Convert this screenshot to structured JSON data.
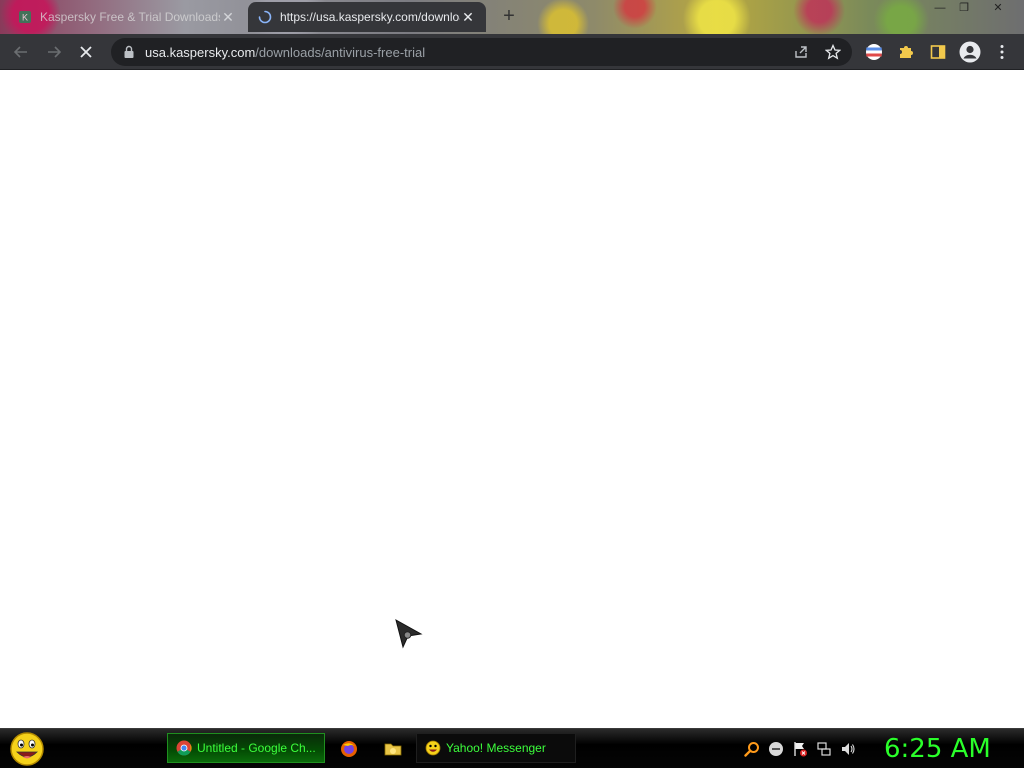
{
  "browser": {
    "tabs": [
      {
        "title": "Kaspersky Free & Trial Downloads",
        "state": "inactive"
      },
      {
        "title": "https://usa.kaspersky.com/downloads/antivirus-free-trial",
        "state": "active-loading"
      }
    ],
    "new_tab_label": "+",
    "window_controls": {
      "minimize": "—",
      "maximize": "❐",
      "close": "✕"
    },
    "address_bar": {
      "host": "usa.kaspersky.com",
      "path": "/downloads/antivirus-free-trial"
    },
    "nav": {
      "back": "←",
      "forward": "→",
      "stop": "✕"
    }
  },
  "taskbar": {
    "tasks": [
      {
        "label": "Untitled - Google Ch...",
        "active": true
      },
      {
        "label": "Yahoo! Messenger",
        "active": false
      }
    ],
    "clock": "6:25 AM"
  },
  "colors": {
    "toolbar_bg": "#35363a",
    "omnibox_bg": "#202124",
    "taskbar_text": "#3cff3c",
    "clock": "#2aff2a"
  }
}
